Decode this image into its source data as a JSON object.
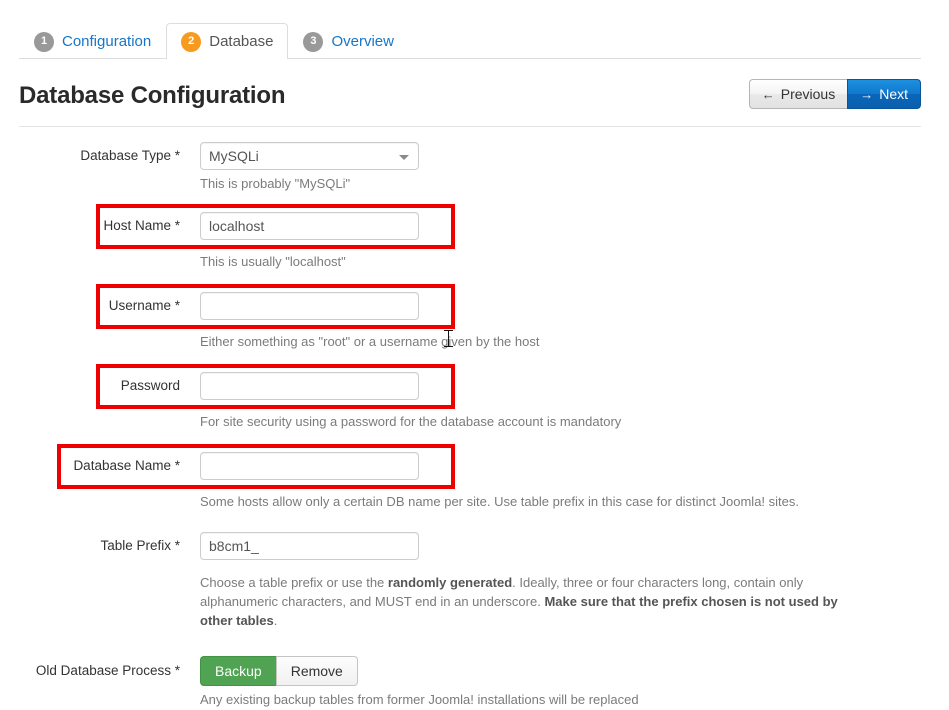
{
  "wizard": {
    "tabs": [
      {
        "num": "1",
        "label": "Configuration",
        "active": false
      },
      {
        "num": "2",
        "label": "Database",
        "active": true
      },
      {
        "num": "3",
        "label": "Overview",
        "active": false
      }
    ]
  },
  "header": {
    "title": "Database Configuration",
    "previous_label": "Previous",
    "next_label": "Next",
    "previous_arrow": "←",
    "next_arrow": "→"
  },
  "form": {
    "database_type": {
      "label": "Database Type *",
      "value": "MySQLi",
      "help": "This is probably \"MySQLi\""
    },
    "host_name": {
      "label": "Host Name *",
      "value": "localhost",
      "help": "This is usually \"localhost\""
    },
    "username": {
      "label": "Username *",
      "value": "",
      "help": "Either something as \"root\" or a username given by the host"
    },
    "password": {
      "label": "Password",
      "value": "",
      "help": "For site security using a password for the database account is mandatory"
    },
    "database_name": {
      "label": "Database Name *",
      "value": "",
      "help": "Some hosts allow only a certain DB name per site. Use table prefix in this case for distinct Joomla! sites."
    },
    "table_prefix": {
      "label": "Table Prefix *",
      "value": "b8cm1_",
      "help_part1": "Choose a table prefix or use the ",
      "help_bold1": "randomly generated",
      "help_part2": ". Ideally, three or four characters long, contain only alphanumeric characters, and MUST end in an underscore. ",
      "help_bold2": "Make sure that the prefix chosen is not used by other tables",
      "help_part3": "."
    },
    "old_database_process": {
      "label": "Old Database Process *",
      "backup_label": "Backup",
      "remove_label": "Remove",
      "selected": "Backup",
      "help": "Any existing backup tables from former Joomla! installations will be replaced"
    }
  },
  "annotations": {
    "highlight_color": "#ee0000",
    "boxes": [
      {
        "name": "host-name-highlight"
      },
      {
        "name": "username-highlight"
      },
      {
        "name": "password-highlight"
      },
      {
        "name": "database-name-highlight"
      }
    ]
  },
  "colors": {
    "tab_active_badge": "#f79a1e",
    "tab_inactive_badge": "#999999",
    "link": "#1676c8",
    "next_button": "#0a66bb",
    "backup_button": "#4fa352"
  }
}
